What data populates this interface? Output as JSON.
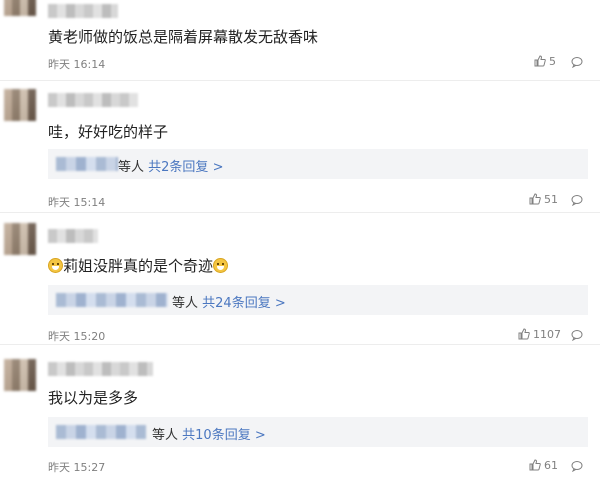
{
  "comments": [
    {
      "text": "黄老师做的饭总是隔着屏幕散发无敌香味",
      "time": "昨天 16:14",
      "likes": "5"
    },
    {
      "text": "哇，好好吃的样子",
      "reply_suffix": "等人",
      "reply_link": "共2条回复",
      "time": "昨天 15:14",
      "likes": "51"
    },
    {
      "text": "莉姐没胖真的是个奇迹",
      "reply_suffix": "等人",
      "reply_link": "共24条回复",
      "time": "昨天 15:20",
      "likes": "1107"
    },
    {
      "text": "我以为是多多",
      "reply_suffix": "等人",
      "reply_link": "共10条回复",
      "time": "昨天 15:27",
      "likes": "61"
    }
  ],
  "icons": {
    "like": "thumbs-up-icon",
    "comment": "comment-bubble-icon",
    "emoji": "grin-emoji-icon"
  },
  "colors": {
    "link": "#4b77c0",
    "meta": "#808080",
    "reply_bg": "#f3f4f6"
  }
}
